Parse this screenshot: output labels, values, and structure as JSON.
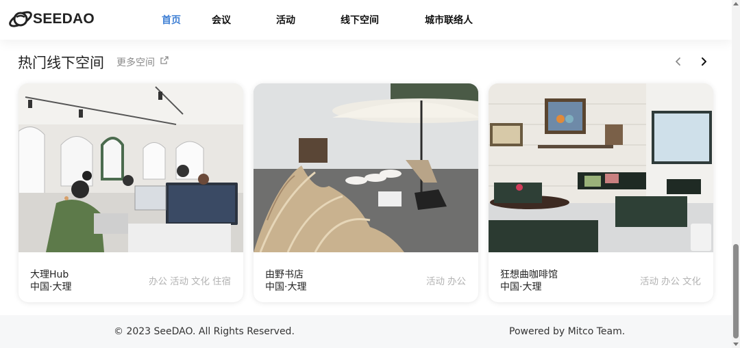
{
  "header": {
    "logo_text": "SEEDAO",
    "nav": [
      {
        "label": "首页",
        "active": true
      },
      {
        "label": "会议",
        "active": false
      },
      {
        "label": "活动",
        "active": false
      },
      {
        "label": "线下空间",
        "active": false
      },
      {
        "label": "城市联络人",
        "active": false
      }
    ]
  },
  "section": {
    "title": "热门线下空间",
    "more_label": "更多空间",
    "more_icon": "external-link-icon",
    "prev_icon": "chevron-left-icon",
    "next_icon": "chevron-right-icon"
  },
  "cards": [
    {
      "name": "大理Hub",
      "location": "中国·大理",
      "tags": [
        "办公",
        "活动",
        "文化",
        "住宿"
      ],
      "photo": "coworking-space-photo"
    },
    {
      "name": "由野书店",
      "location": "中国·大理",
      "tags": [
        "活动",
        "办公"
      ],
      "photo": "courtyard-umbrella-photo"
    },
    {
      "name": "狂想曲咖啡馆",
      "location": "中国·大理",
      "tags": [
        "活动",
        "办公",
        "文化"
      ],
      "photo": "cafe-interior-photo"
    }
  ],
  "footer": {
    "copyright": "© 2023 SeeDAO. All Rights Reserved.",
    "powered": "Powered by Mitco Team."
  },
  "colors": {
    "nav_active": "#3f7fd4",
    "tag_text": "#b3b3b3",
    "footer_bg": "#f6f7f8"
  }
}
